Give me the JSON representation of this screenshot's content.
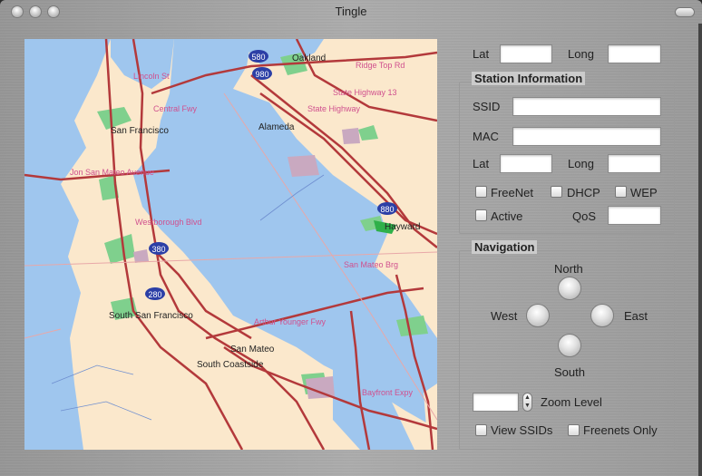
{
  "window": {
    "title": "Tingle"
  },
  "coords": {
    "lat_label": "Lat",
    "long_label": "Long",
    "lat_value": "",
    "long_value": ""
  },
  "station": {
    "title": "Station Information",
    "ssid_label": "SSID",
    "ssid_value": "",
    "mac_label": "MAC",
    "mac_value": "",
    "lat_label": "Lat",
    "lat_value": "",
    "long_label": "Long",
    "long_value": "",
    "freenet_label": "FreeNet",
    "dhcp_label": "DHCP",
    "wep_label": "WEP",
    "active_label": "Active",
    "qos_label": "QoS",
    "qos_value": ""
  },
  "navigation": {
    "title": "Navigation",
    "north": "North",
    "south": "South",
    "east": "East",
    "west": "West",
    "zoom_label": "Zoom Level",
    "zoom_value": "",
    "view_ssids_label": "View SSIDs",
    "freenets_only_label": "Freenets Only"
  },
  "map": {
    "places": [
      "Oakland",
      "San Francisco",
      "Alameda",
      "Hayward",
      "South San Francisco",
      "San Mateo",
      "South Coastside"
    ],
    "roads": [
      "Central Fwy",
      "Ridge Top Rd",
      "State Highway 13",
      "State Highway",
      "Westborough Blvd",
      "Arthur Younger Fwy",
      "San Mateo Brg",
      "Bayfront Expy",
      "Jon San Mateo Avenue",
      "Lincoln St"
    ],
    "shields": [
      "580",
      "980",
      "880",
      "380",
      "280"
    ],
    "colors": {
      "water": "#9fc6ee",
      "land": "#fbe8cc",
      "park": "#7fd08d",
      "road": "#b3393b"
    }
  }
}
